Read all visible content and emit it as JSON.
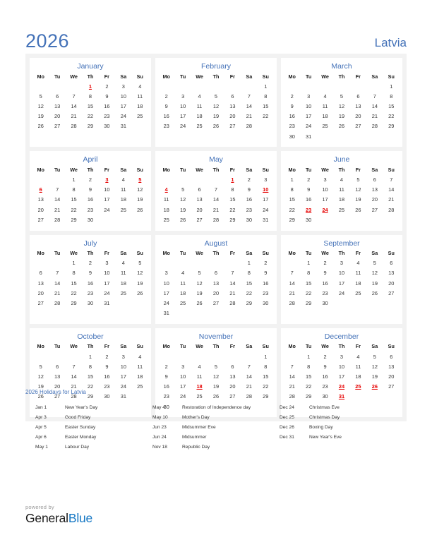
{
  "header": {
    "year": "2026",
    "country": "Latvia",
    "accent_color": "#4472b8",
    "holiday_color": "#e60000"
  },
  "weekday_headers": [
    "Mo",
    "Tu",
    "We",
    "Th",
    "Fr",
    "Sa",
    "Su"
  ],
  "months": [
    {
      "name": "January",
      "weeks": [
        [
          "",
          "",
          "",
          "1",
          "2",
          "3",
          "4"
        ],
        [
          "5",
          "6",
          "7",
          "8",
          "9",
          "10",
          "11"
        ],
        [
          "12",
          "13",
          "14",
          "15",
          "16",
          "17",
          "18"
        ],
        [
          "19",
          "20",
          "21",
          "22",
          "23",
          "24",
          "25"
        ],
        [
          "26",
          "27",
          "28",
          "29",
          "30",
          "31",
          ""
        ]
      ],
      "holidays": [
        "1"
      ]
    },
    {
      "name": "February",
      "weeks": [
        [
          "",
          "",
          "",
          "",
          "",
          "",
          "1"
        ],
        [
          "2",
          "3",
          "4",
          "5",
          "6",
          "7",
          "8"
        ],
        [
          "9",
          "10",
          "11",
          "12",
          "13",
          "14",
          "15"
        ],
        [
          "16",
          "17",
          "18",
          "19",
          "20",
          "21",
          "22"
        ],
        [
          "23",
          "24",
          "25",
          "26",
          "27",
          "28",
          ""
        ]
      ],
      "holidays": []
    },
    {
      "name": "March",
      "weeks": [
        [
          "",
          "",
          "",
          "",
          "",
          "",
          "1"
        ],
        [
          "2",
          "3",
          "4",
          "5",
          "6",
          "7",
          "8"
        ],
        [
          "9",
          "10",
          "11",
          "12",
          "13",
          "14",
          "15"
        ],
        [
          "16",
          "17",
          "18",
          "19",
          "20",
          "21",
          "22"
        ],
        [
          "23",
          "24",
          "25",
          "26",
          "27",
          "28",
          "29"
        ],
        [
          "30",
          "31",
          "",
          "",
          "",
          "",
          ""
        ]
      ],
      "holidays": []
    },
    {
      "name": "April",
      "weeks": [
        [
          "",
          "",
          "1",
          "2",
          "3",
          "4",
          "5"
        ],
        [
          "6",
          "7",
          "8",
          "9",
          "10",
          "11",
          "12"
        ],
        [
          "13",
          "14",
          "15",
          "16",
          "17",
          "18",
          "19"
        ],
        [
          "20",
          "21",
          "22",
          "23",
          "24",
          "25",
          "26"
        ],
        [
          "27",
          "28",
          "29",
          "30",
          "",
          "",
          ""
        ]
      ],
      "holidays": [
        "3",
        "5",
        "6"
      ]
    },
    {
      "name": "May",
      "weeks": [
        [
          "",
          "",
          "",
          "",
          "1",
          "2",
          "3"
        ],
        [
          "4",
          "5",
          "6",
          "7",
          "8",
          "9",
          "10"
        ],
        [
          "11",
          "12",
          "13",
          "14",
          "15",
          "16",
          "17"
        ],
        [
          "18",
          "19",
          "20",
          "21",
          "22",
          "23",
          "24"
        ],
        [
          "25",
          "26",
          "27",
          "28",
          "29",
          "30",
          "31"
        ]
      ],
      "holidays": [
        "1",
        "4",
        "10"
      ]
    },
    {
      "name": "June",
      "weeks": [
        [
          "1",
          "2",
          "3",
          "4",
          "5",
          "6",
          "7"
        ],
        [
          "8",
          "9",
          "10",
          "11",
          "12",
          "13",
          "14"
        ],
        [
          "15",
          "16",
          "17",
          "18",
          "19",
          "20",
          "21"
        ],
        [
          "22",
          "23",
          "24",
          "25",
          "26",
          "27",
          "28"
        ],
        [
          "29",
          "30",
          "",
          "",
          "",
          "",
          ""
        ]
      ],
      "holidays": [
        "23",
        "24"
      ]
    },
    {
      "name": "July",
      "weeks": [
        [
          "",
          "",
          "1",
          "2",
          "3",
          "4",
          "5"
        ],
        [
          "6",
          "7",
          "8",
          "9",
          "10",
          "11",
          "12"
        ],
        [
          "13",
          "14",
          "15",
          "16",
          "17",
          "18",
          "19"
        ],
        [
          "20",
          "21",
          "22",
          "23",
          "24",
          "25",
          "26"
        ],
        [
          "27",
          "28",
          "29",
          "30",
          "31",
          "",
          ""
        ]
      ],
      "holidays": []
    },
    {
      "name": "August",
      "weeks": [
        [
          "",
          "",
          "",
          "",
          "",
          "1",
          "2"
        ],
        [
          "3",
          "4",
          "5",
          "6",
          "7",
          "8",
          "9"
        ],
        [
          "10",
          "11",
          "12",
          "13",
          "14",
          "15",
          "16"
        ],
        [
          "17",
          "18",
          "19",
          "20",
          "21",
          "22",
          "23"
        ],
        [
          "24",
          "25",
          "26",
          "27",
          "28",
          "29",
          "30"
        ],
        [
          "31",
          "",
          "",
          "",
          "",
          "",
          ""
        ]
      ],
      "holidays": []
    },
    {
      "name": "September",
      "weeks": [
        [
          "",
          "1",
          "2",
          "3",
          "4",
          "5",
          "6"
        ],
        [
          "7",
          "8",
          "9",
          "10",
          "11",
          "12",
          "13"
        ],
        [
          "14",
          "15",
          "16",
          "17",
          "18",
          "19",
          "20"
        ],
        [
          "21",
          "22",
          "23",
          "24",
          "25",
          "26",
          "27"
        ],
        [
          "28",
          "29",
          "30",
          "",
          "",
          "",
          ""
        ]
      ],
      "holidays": []
    },
    {
      "name": "October",
      "weeks": [
        [
          "",
          "",
          "",
          "1",
          "2",
          "3",
          "4"
        ],
        [
          "5",
          "6",
          "7",
          "8",
          "9",
          "10",
          "11"
        ],
        [
          "12",
          "13",
          "14",
          "15",
          "16",
          "17",
          "18"
        ],
        [
          "19",
          "20",
          "21",
          "22",
          "23",
          "24",
          "25"
        ],
        [
          "26",
          "27",
          "28",
          "29",
          "30",
          "31",
          ""
        ]
      ],
      "holidays": []
    },
    {
      "name": "November",
      "weeks": [
        [
          "",
          "",
          "",
          "",
          "",
          "",
          "1"
        ],
        [
          "2",
          "3",
          "4",
          "5",
          "6",
          "7",
          "8"
        ],
        [
          "9",
          "10",
          "11",
          "12",
          "13",
          "14",
          "15"
        ],
        [
          "16",
          "17",
          "18",
          "19",
          "20",
          "21",
          "22"
        ],
        [
          "23",
          "24",
          "25",
          "26",
          "27",
          "28",
          "29"
        ],
        [
          "30",
          "",
          "",
          "",
          "",
          "",
          ""
        ]
      ],
      "holidays": [
        "18"
      ]
    },
    {
      "name": "December",
      "weeks": [
        [
          "",
          "1",
          "2",
          "3",
          "4",
          "5",
          "6"
        ],
        [
          "7",
          "8",
          "9",
          "10",
          "11",
          "12",
          "13"
        ],
        [
          "14",
          "15",
          "16",
          "17",
          "18",
          "19",
          "20"
        ],
        [
          "21",
          "22",
          "23",
          "24",
          "25",
          "26",
          "27"
        ],
        [
          "28",
          "29",
          "30",
          "31",
          "",
          "",
          ""
        ]
      ],
      "holidays": [
        "24",
        "25",
        "26",
        "31"
      ]
    }
  ],
  "holidays_section": {
    "heading": "2026 Holidays for Latvia",
    "columns": [
      [
        {
          "date": "Jan 1",
          "name": "New Year's Day"
        },
        {
          "date": "Apr 3",
          "name": "Good Friday"
        },
        {
          "date": "Apr 5",
          "name": "Easter Sunday"
        },
        {
          "date": "Apr 6",
          "name": "Easter Monday"
        },
        {
          "date": "May 1",
          "name": "Labour Day"
        }
      ],
      [
        {
          "date": "May 4",
          "name": "Restoration of Independence day"
        },
        {
          "date": "May 10",
          "name": "Mother's Day"
        },
        {
          "date": "Jun 23",
          "name": "Midsummer Eve"
        },
        {
          "date": "Jun 24",
          "name": "Midsummer"
        },
        {
          "date": "Nov 18",
          "name": "Republic Day"
        }
      ],
      [
        {
          "date": "Dec 24",
          "name": "Christmas Eve"
        },
        {
          "date": "Dec 25",
          "name": "Christmas Day"
        },
        {
          "date": "Dec 26",
          "name": "Boxing Day"
        },
        {
          "date": "Dec 31",
          "name": "New Year's Eve"
        }
      ]
    ]
  },
  "footer": {
    "powered_by": "powered by",
    "logo_part_1": "General",
    "logo_part_2": "Blue"
  }
}
